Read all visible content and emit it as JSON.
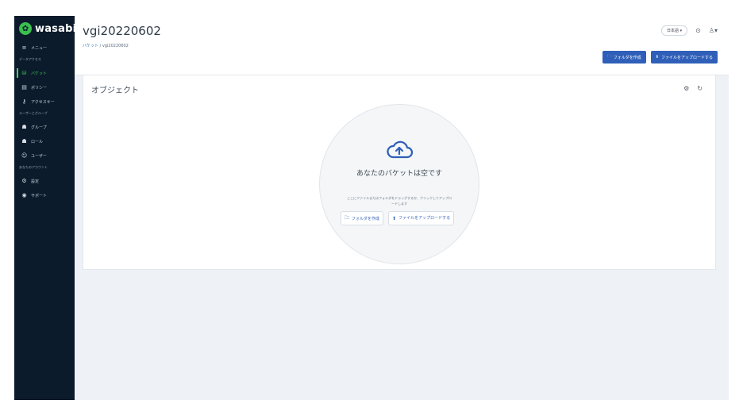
{
  "app": {
    "logo_text": "wasabi"
  },
  "sidebar": {
    "items": [
      {
        "id": "menu",
        "icon": "menu-icon",
        "glyph": "≡",
        "label": "メニュー"
      },
      {
        "section": true,
        "label": "データアクセス"
      },
      {
        "id": "buckets",
        "icon": "bucket-icon",
        "glyph": "⛁",
        "label": "バケット",
        "active": true
      },
      {
        "id": "policy",
        "icon": "document-icon",
        "glyph": "▤",
        "label": "ポリシー"
      },
      {
        "id": "access-keys",
        "icon": "key-icon",
        "glyph": "⚷",
        "label": "アクセスキー"
      },
      {
        "section": true,
        "label": "ユーザーとグループ"
      },
      {
        "id": "groups",
        "icon": "group-icon",
        "glyph": "☗",
        "label": "グループ"
      },
      {
        "id": "roles",
        "icon": "role-icon",
        "glyph": "☗",
        "label": "ロール"
      },
      {
        "id": "users",
        "icon": "user-icon",
        "glyph": "☺",
        "label": "ユーザー"
      },
      {
        "section": true,
        "label": "あなたのアカウント"
      },
      {
        "id": "settings",
        "icon": "gear-icon",
        "glyph": "⚙",
        "label": "設定"
      },
      {
        "id": "support",
        "icon": "support-icon",
        "glyph": "◉",
        "label": "サポート"
      }
    ]
  },
  "header": {
    "bucket_name": "vgi20220602",
    "breadcrumb": {
      "root": "バケット",
      "sep": "/",
      "current": "vgi20220602"
    },
    "language": "日本語 ▾",
    "help_icon": "clock-icon",
    "user_icon": "user-icon",
    "actions": [
      {
        "icon": "folder-icon",
        "glyph": "🗀",
        "label": "フォルダを作成"
      },
      {
        "icon": "upload-icon",
        "glyph": "⬆",
        "label": "ファイルをアップロードする"
      }
    ]
  },
  "objects": {
    "title": "オブジェクト",
    "panel_icons": [
      "settings-icon",
      "refresh-icon"
    ],
    "empty": {
      "title": "あなたのバケットは空です",
      "subtitle": "ここにファイルまたはフォルダをドラッグするか、クリックしてアップロードします",
      "buttons": [
        {
          "icon": "folder-icon",
          "glyph": "🗀",
          "label": "フォルダを作成"
        },
        {
          "icon": "upload-icon",
          "glyph": "⬆",
          "label": "ファイルをアップロードする"
        }
      ]
    }
  },
  "colors": {
    "sidebar_bg": "#0b1b2b",
    "accent_green": "#4ad05c",
    "primary_blue": "#2f5fb8",
    "panel_bg": "#ffffff",
    "content_bg": "#eef2f6"
  }
}
